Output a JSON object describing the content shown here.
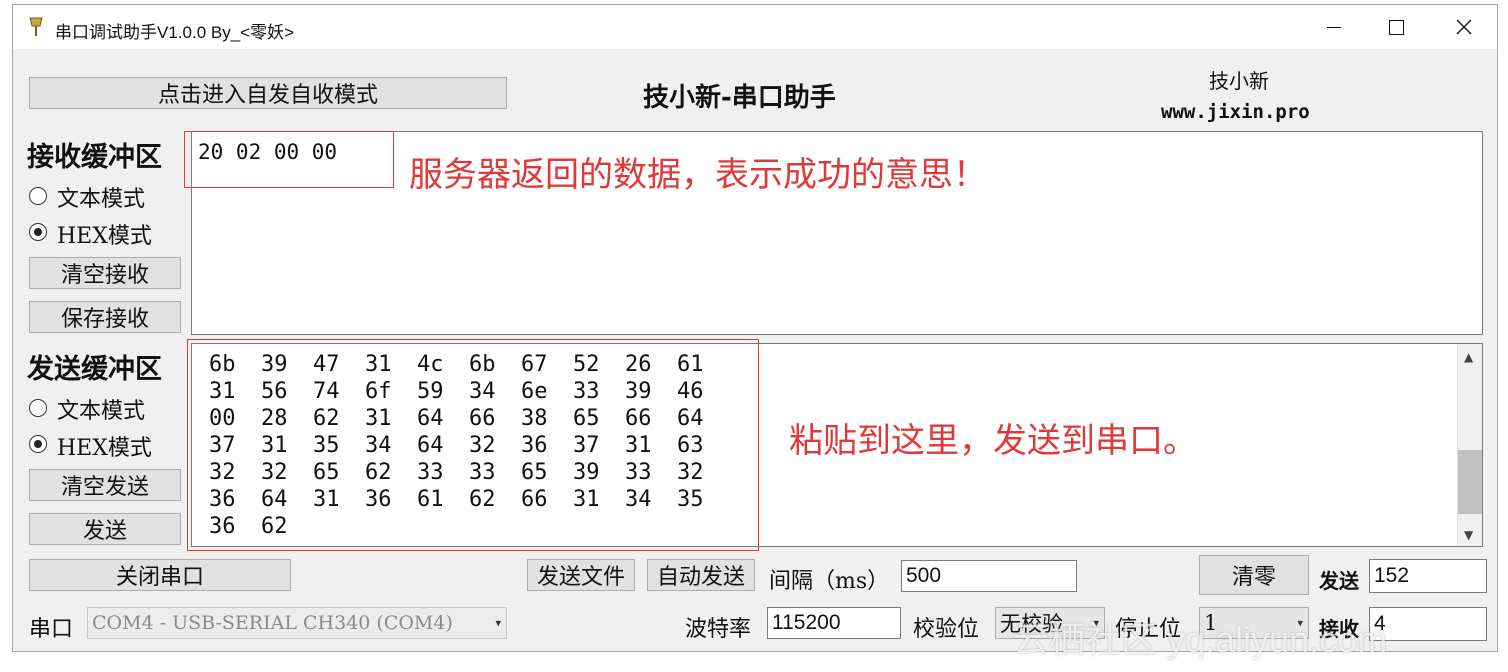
{
  "window": {
    "title": "串口调试助手V1.0.0 By_<零妖>"
  },
  "header": {
    "self_test_button": "点击进入自发自收模式",
    "app_name": "技小新-串口助手",
    "brand_name": "技小新",
    "brand_url": "www.jixin.pro"
  },
  "receive": {
    "label": "接收缓冲区",
    "mode_text": "文本模式",
    "mode_hex": "HEX模式",
    "selected_mode": "hex",
    "clear_button": "清空接收",
    "save_button": "保存接收",
    "content": "20 02 00 00",
    "annotation": "服务器返回的数据，表示成功的意思！"
  },
  "send": {
    "label": "发送缓冲区",
    "mode_text": "文本模式",
    "mode_hex": "HEX模式",
    "selected_mode": "hex",
    "clear_button": "清空发送",
    "send_button": "发送",
    "annotation": "粘贴到这里，发送到串口。",
    "hex_rows": [
      [
        "6b",
        "39",
        "47",
        "31",
        "4c",
        "6b",
        "67",
        "52",
        "26",
        "61"
      ],
      [
        "31",
        "56",
        "74",
        "6f",
        "59",
        "34",
        "6e",
        "33",
        "39",
        "46"
      ],
      [
        "00",
        "28",
        "62",
        "31",
        "64",
        "66",
        "38",
        "65",
        "66",
        "64"
      ],
      [
        "37",
        "31",
        "35",
        "34",
        "64",
        "32",
        "36",
        "37",
        "31",
        "63"
      ],
      [
        "32",
        "32",
        "65",
        "62",
        "33",
        "33",
        "65",
        "39",
        "33",
        "32"
      ],
      [
        "36",
        "64",
        "31",
        "36",
        "61",
        "62",
        "66",
        "31",
        "34",
        "35"
      ],
      [
        "36",
        "62"
      ]
    ]
  },
  "controls": {
    "close_port_button": "关闭串口",
    "send_file_button": "发送文件",
    "auto_send_button": "自动发送",
    "interval_label": "间隔（ms）",
    "interval_value": "500",
    "reset_button": "清零",
    "send_count_label": "发送",
    "send_count": "152",
    "receive_count_label": "接收",
    "receive_count": "4",
    "port_label": "串口",
    "port_value": "COM4 - USB-SERIAL CH340 (COM4)",
    "baud_label": "波特率",
    "baud_value": "115200",
    "parity_label": "校验位",
    "parity_value": "无校验",
    "stopbits_label": "停止位",
    "stopbits_value": "1"
  },
  "watermark": "云栖社区 yq.aliyun.com",
  "colors": {
    "annotation_red": "#e0393a",
    "window_bg": "#f0f0f0"
  }
}
